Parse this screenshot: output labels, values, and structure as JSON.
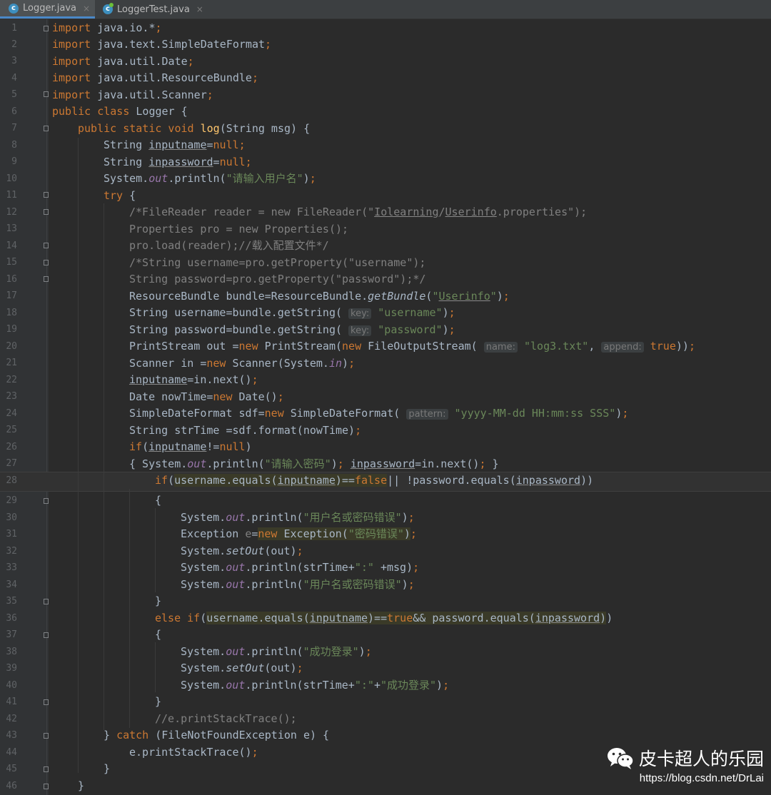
{
  "tabs": [
    {
      "label": "Logger.java",
      "icon": "java-class-icon",
      "active": true
    },
    {
      "label": "LoggerTest.java",
      "icon": "java-class-icon",
      "active": false
    }
  ],
  "close_glyph": "×",
  "code_lines": [
    {
      "n": "1",
      "t": "import java.io.*;"
    },
    {
      "n": "2",
      "t": "import java.text.SimpleDateFormat;"
    },
    {
      "n": "3",
      "t": "import java.util.Date;"
    },
    {
      "n": "4",
      "t": "import java.util.ResourceBundle;"
    },
    {
      "n": "5",
      "t": "import java.util.Scanner;"
    },
    {
      "n": "6",
      "t": "public class Logger {"
    },
    {
      "n": "7",
      "t": "public static void log(String msg) {"
    },
    {
      "n": "8",
      "t": "String inputname=null;"
    },
    {
      "n": "9",
      "t": "String inpassword=null;"
    },
    {
      "n": "10",
      "t": "System.out.println(\"请输入用户名\");"
    },
    {
      "n": "11",
      "t": "try {"
    },
    {
      "n": "12",
      "t": "/*FileReader reader = new FileReader(\"Iolearning/Userinfo.properties\");"
    },
    {
      "n": "13",
      "t": "Properties pro = new Properties();"
    },
    {
      "n": "14",
      "t": "pro.load(reader);//载入配置文件*/"
    },
    {
      "n": "15",
      "t": "/*String username=pro.getProperty(\"username\");"
    },
    {
      "n": "16",
      "t": "String password=pro.getProperty(\"password\");*/"
    },
    {
      "n": "17",
      "t": "ResourceBundle bundle=ResourceBundle.getBundle(\"Userinfo\");"
    },
    {
      "n": "18",
      "t": "String username=bundle.getString( key: \"username\");"
    },
    {
      "n": "19",
      "t": "String password=bundle.getString( key: \"password\");"
    },
    {
      "n": "20",
      "t": "PrintStream out =new PrintStream(new FileOutputStream( name: \"log3.txt\", append: true));"
    },
    {
      "n": "21",
      "t": "Scanner in =new Scanner(System.in);"
    },
    {
      "n": "22",
      "t": "inputname=in.next();"
    },
    {
      "n": "23",
      "t": "Date nowTime=new Date();"
    },
    {
      "n": "24",
      "t": "SimpleDateFormat sdf=new SimpleDateFormat( pattern: \"yyyy-MM-dd HH:mm:ss SSS\");"
    },
    {
      "n": "25",
      "t": "String strTime =sdf.format(nowTime);"
    },
    {
      "n": "26",
      "t": "if(inputname!=null)"
    },
    {
      "n": "27",
      "t": "{ System.out.println(\"请输入密码\"); inpassword=in.next(); }"
    },
    {
      "n": "28",
      "t": "if(username.equals(inputname)==false|| !password.equals(inpassword))"
    },
    {
      "n": "29",
      "t": "{"
    },
    {
      "n": "30",
      "t": "System.out.println(\"用户名或密码错误\");"
    },
    {
      "n": "31",
      "t": "Exception e=new Exception(\"密码错误\");"
    },
    {
      "n": "32",
      "t": "System.setOut(out);"
    },
    {
      "n": "33",
      "t": "System.out.println(strTime+\":\" +msg);"
    },
    {
      "n": "34",
      "t": "System.out.println(\"用户名或密码错误\");"
    },
    {
      "n": "35",
      "t": "}"
    },
    {
      "n": "36",
      "t": "else if(username.equals(inputname)==true&& password.equals(inpassword))"
    },
    {
      "n": "37",
      "t": "{"
    },
    {
      "n": "38",
      "t": "System.out.println(\"成功登录\");"
    },
    {
      "n": "39",
      "t": "System.setOut(out);"
    },
    {
      "n": "40",
      "t": "System.out.println(strTime+\":\"+\"成功登录\");"
    },
    {
      "n": "41",
      "t": "}"
    },
    {
      "n": "42",
      "t": "//e.printStackTrace();"
    },
    {
      "n": "43",
      "t": "} catch (FileNotFoundException e) {"
    },
    {
      "n": "44",
      "t": "e.printStackTrace();"
    },
    {
      "n": "45",
      "t": "}"
    },
    {
      "n": "46",
      "t": "}"
    }
  ],
  "watermark": {
    "title": "皮卡超人的乐园",
    "url": "https://blog.csdn.net/DrLai",
    "icon": "wechat-icon"
  },
  "colors": {
    "background": "#2b2b2b",
    "keyword": "#cc7832",
    "string": "#6a8759",
    "comment": "#808080",
    "field": "#9876aa",
    "method": "#ffc66d",
    "text": "#a9b7c6"
  }
}
